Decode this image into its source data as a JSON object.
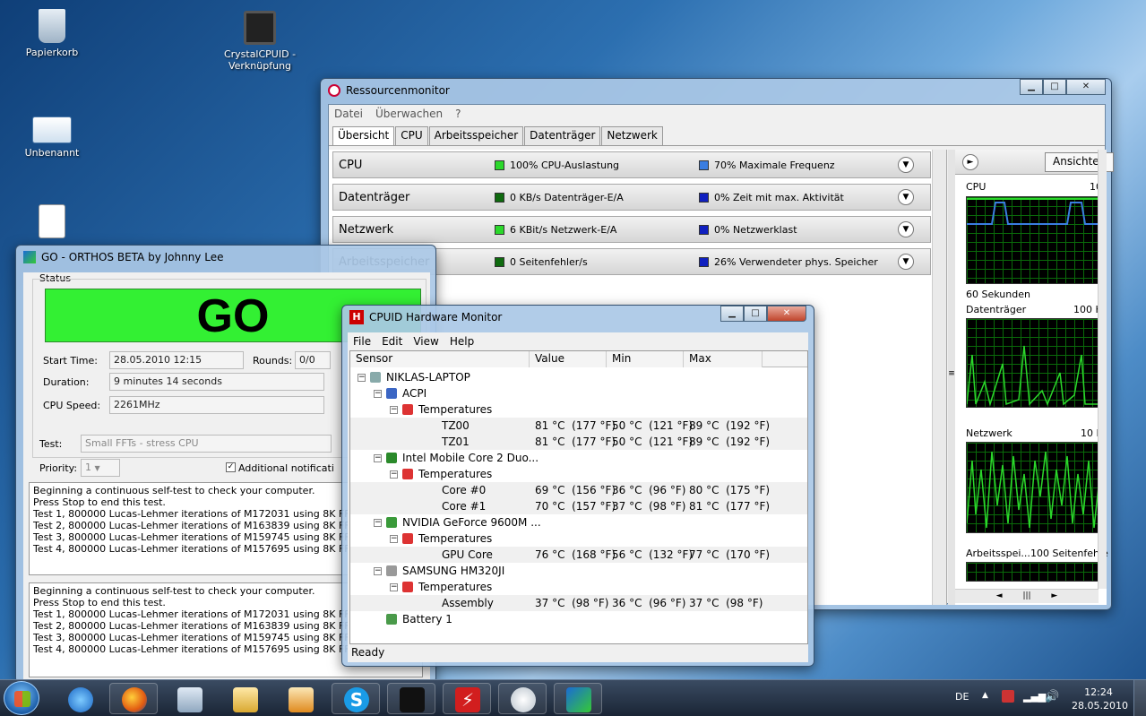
{
  "desktop": {
    "icons": [
      {
        "label1": "Papierkorb",
        "label2": ""
      },
      {
        "label1": "CrystalCPUID -",
        "label2": "Verknüpfung"
      },
      {
        "label1": "Unbenannt",
        "label2": ""
      }
    ]
  },
  "resmon": {
    "title": "Ressourcenmonitor",
    "menu": [
      "Datei",
      "Überwachen",
      "?"
    ],
    "tabs": [
      "Übersicht",
      "CPU",
      "Arbeitsspeicher",
      "Datenträger",
      "Netzwerk"
    ],
    "sections": [
      {
        "name": "CPU",
        "info1": "100% CPU-Auslastung",
        "info2": "70% Maximale Frequenz",
        "c1": "#2bd82b",
        "c2": "#3a7de0"
      },
      {
        "name": "Datenträger",
        "info1": "0 KB/s Datenträger-E/A",
        "info2": "0% Zeit mit max. Aktivität",
        "c1": "#0e6a0e",
        "c2": "#1020c0"
      },
      {
        "name": "Netzwerk",
        "info1": "6 KBit/s Netzwerk-E/A",
        "info2": "0% Netzwerklast",
        "c1": "#2bd82b",
        "c2": "#1020c0"
      },
      {
        "name": "Arbeitsspeicher",
        "info1": "0 Seitenfehler/s",
        "info2": "26% Verwendeter phys. Speicher",
        "c1": "#0e6a0e",
        "c2": "#1020c0"
      }
    ],
    "side": {
      "views_button": "Ansichten",
      "cpu_label": "CPU",
      "cpu_max": "10",
      "sixty": "60 Sekunden",
      "disk_label": "Datenträger",
      "disk_max": "100 K",
      "net_label": "Netzwerk",
      "net_max": "10 K",
      "mem_label": "Arbeitsspei...",
      "mem_max": "100 Seitenfehle"
    }
  },
  "orthos": {
    "title": "GO - ORTHOS BETA by Johnny Lee",
    "status_label": "Status",
    "go": "GO",
    "start_label": "Start Time:",
    "start_value": "28.05.2010 12:15",
    "rounds_label": "Rounds:",
    "rounds_value": "0/0",
    "duration_label": "Duration:",
    "duration_value": "9 minutes 14 seconds",
    "speed_label": "CPU Speed:",
    "speed_value": "2261MHz",
    "test_label": "Test:",
    "test_value": "Small FFTs - stress CPU",
    "priority_label": "Priority:",
    "priority_value": "1",
    "additional": "Additional notificati",
    "log1": [
      "Beginning a continuous self-test to check your computer.",
      "Press Stop to end this test.",
      "Test 1, 800000 Lucas-Lehmer iterations of M172031 using 8K FFT l",
      "Test 2, 800000 Lucas-Lehmer iterations of M163839 using 8K FFT l",
      "Test 3, 800000 Lucas-Lehmer iterations of M159745 using 8K FFT l",
      "Test 4, 800000 Lucas-Lehmer iterations of M157695 using 8K FFT l"
    ],
    "log2": [
      "Beginning a continuous self-test to check your computer.",
      "Press Stop to end this test.",
      "Test 1, 800000 Lucas-Lehmer iterations of M172031 using 8K FFT lengt",
      "Test 2, 800000 Lucas-Lehmer iterations of M163839 using 8K FFT lengt",
      "Test 3, 800000 Lucas-Lehmer iterations of M159745 using 8K FFT lengt",
      "Test 4, 800000 Lucas-Lehmer iterations of M157695 using 8K FFT lengt"
    ]
  },
  "hwmon": {
    "title": "CPUID Hardware Monitor",
    "menu": [
      "File",
      "Edit",
      "View",
      "Help"
    ],
    "columns": [
      "Sensor",
      "Value",
      "Min",
      "Max"
    ],
    "rows": [
      {
        "label": "NIKLAS-LAPTOP",
        "level": 0,
        "icon": "computer-icon",
        "value": "",
        "min": "",
        "max": ""
      },
      {
        "label": "ACPI",
        "level": 1,
        "icon": "acpi-icon",
        "value": "",
        "min": "",
        "max": ""
      },
      {
        "label": "Temperatures",
        "level": 2,
        "icon": "thermometer-icon",
        "value": "",
        "min": "",
        "max": ""
      },
      {
        "label": "TZ00",
        "level": 3,
        "icon": "",
        "value": "81 °C  (177 °F)",
        "min": "50 °C  (121 °F)",
        "max": "89 °C  (192 °F)"
      },
      {
        "label": "TZ01",
        "level": 3,
        "icon": "",
        "value": "81 °C  (177 °F)",
        "min": "50 °C  (121 °F)",
        "max": "89 °C  (192 °F)"
      },
      {
        "label": "Intel Mobile Core 2 Duo...",
        "level": 1,
        "icon": "cpu-chip-icon",
        "value": "",
        "min": "",
        "max": ""
      },
      {
        "label": "Temperatures",
        "level": 2,
        "icon": "thermometer-icon",
        "value": "",
        "min": "",
        "max": ""
      },
      {
        "label": "Core #0",
        "level": 3,
        "icon": "",
        "value": "69 °C  (156 °F)",
        "min": "36 °C  (96 °F)",
        "max": "80 °C  (175 °F)"
      },
      {
        "label": "Core #1",
        "level": 3,
        "icon": "",
        "value": "70 °C  (157 °F)",
        "min": "37 °C  (98 °F)",
        "max": "81 °C  (177 °F)"
      },
      {
        "label": "NVIDIA GeForce 9600M ...",
        "level": 1,
        "icon": "gpu-icon",
        "value": "",
        "min": "",
        "max": ""
      },
      {
        "label": "Temperatures",
        "level": 2,
        "icon": "thermometer-icon",
        "value": "",
        "min": "",
        "max": ""
      },
      {
        "label": "GPU Core",
        "level": 3,
        "icon": "",
        "value": "76 °C  (168 °F)",
        "min": "56 °C  (132 °F)",
        "max": "77 °C  (170 °F)"
      },
      {
        "label": "SAMSUNG HM320JI",
        "level": 1,
        "icon": "hard-disk-icon",
        "value": "",
        "min": "",
        "max": ""
      },
      {
        "label": "Temperatures",
        "level": 2,
        "icon": "thermometer-icon",
        "value": "",
        "min": "",
        "max": ""
      },
      {
        "label": "Assembly",
        "level": 3,
        "icon": "",
        "value": "37 °C  (98 °F)",
        "min": "36 °C  (96 °F)",
        "max": "37 °C  (98 °F)"
      },
      {
        "label": "Battery 1",
        "level": 1,
        "icon": "battery-icon",
        "value": "",
        "min": "",
        "max": ""
      }
    ],
    "status": "Ready"
  },
  "taskbar": {
    "lang": "DE",
    "time": "12:24",
    "date": "28.05.2010"
  }
}
